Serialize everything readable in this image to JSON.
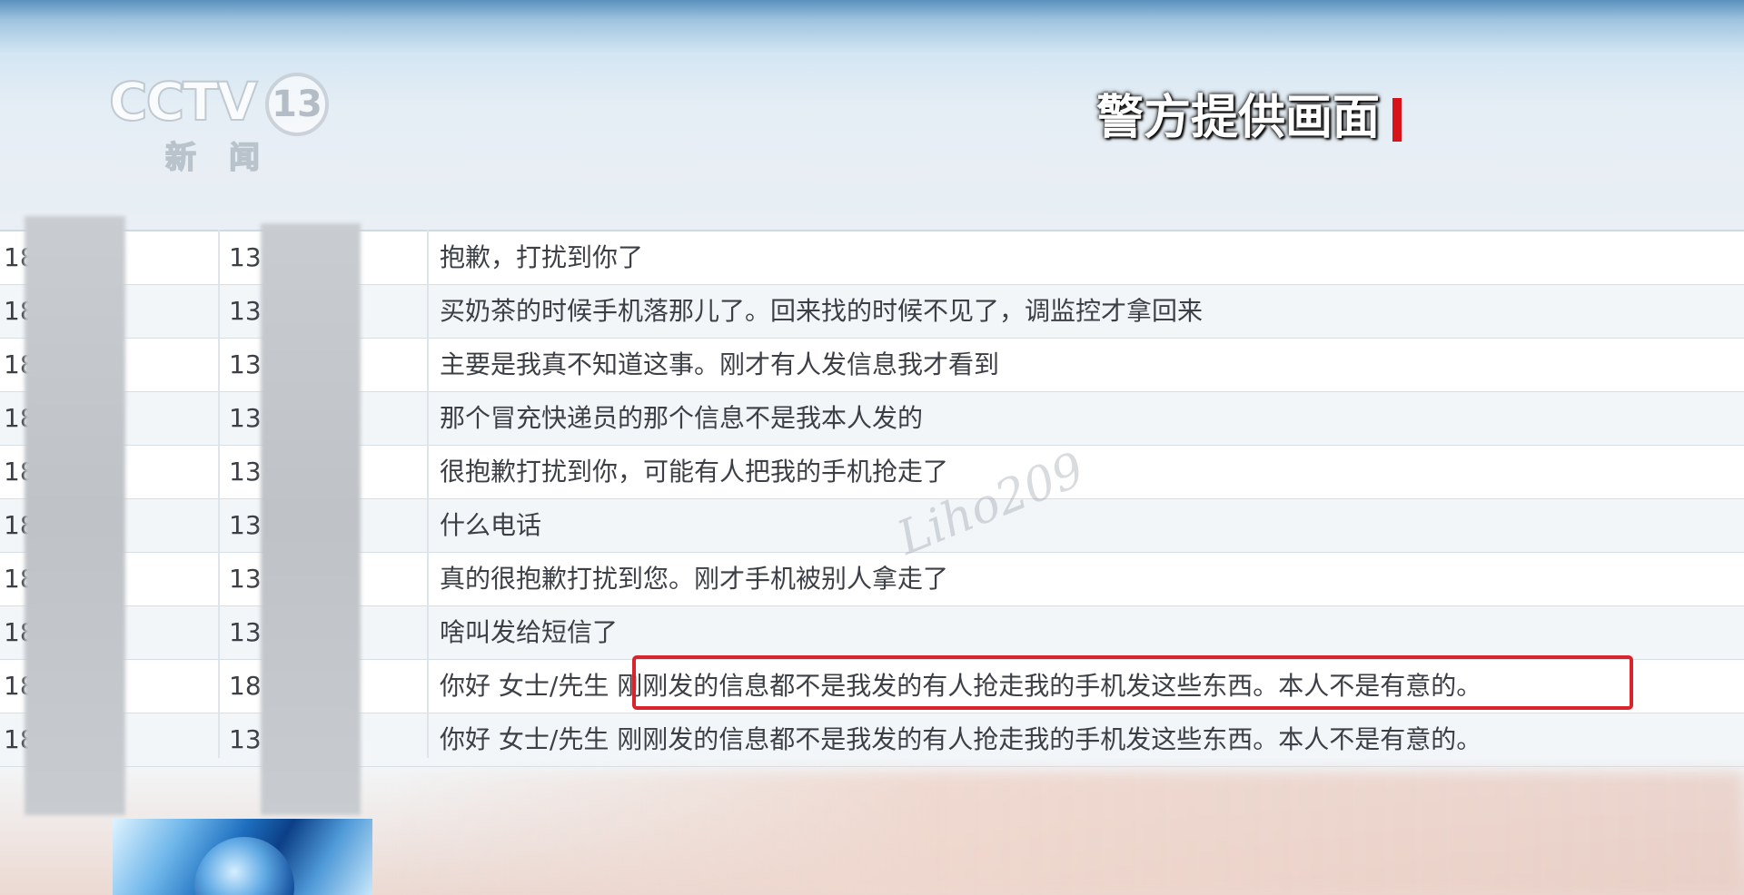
{
  "logo": {
    "brand": "CCTV",
    "channel": "13",
    "subtitle": "新闻"
  },
  "caption": {
    "text": "警方提供画面",
    "bar_color": "#d8141a"
  },
  "watermark": "Liho209",
  "colors": {
    "highlight": "#d9242d",
    "row_alt": "#f2f6f9",
    "text": "#3c4046"
  },
  "rows": [
    {
      "from": "18          790",
      "to": "13          999",
      "message": "抱歉，打扰到你了"
    },
    {
      "from": "18          790",
      "to": "13          999",
      "message": "买奶茶的时候手机落那儿了。回来找的时候不见了，调监控才拿回来"
    },
    {
      "from": "18          790",
      "to": "13          999",
      "message": "主要是我真不知道这事。刚才有人发信息我才看到"
    },
    {
      "from": "18          790",
      "to": "13          999",
      "message": "那个冒充快递员的那个信息不是我本人发的"
    },
    {
      "from": "18          790",
      "to": "13          999",
      "message": "很抱歉打扰到你，可能有人把我的手机抢走了"
    },
    {
      "from": "18          790",
      "to": "13          999",
      "message": "什么电话"
    },
    {
      "from": "18          790",
      "to": "13          999",
      "message": "真的很抱歉打扰到您。刚才手机被别人拿走了"
    },
    {
      "from": "18          790",
      "to": "13          999",
      "message": "啥叫发给短信了"
    },
    {
      "from": "18          790",
      "to": "18          392",
      "message": "你好 女士/先生 刚刚发的信息都不是我发的有人抢走我的手机发这些东西。本人不是有意的。"
    },
    {
      "from": "18          790",
      "to": "13          211",
      "message": "你好 女士/先生 刚刚发的信息都不是我发的有人抢走我的手机发这些东西。本人不是有意的。"
    }
  ]
}
